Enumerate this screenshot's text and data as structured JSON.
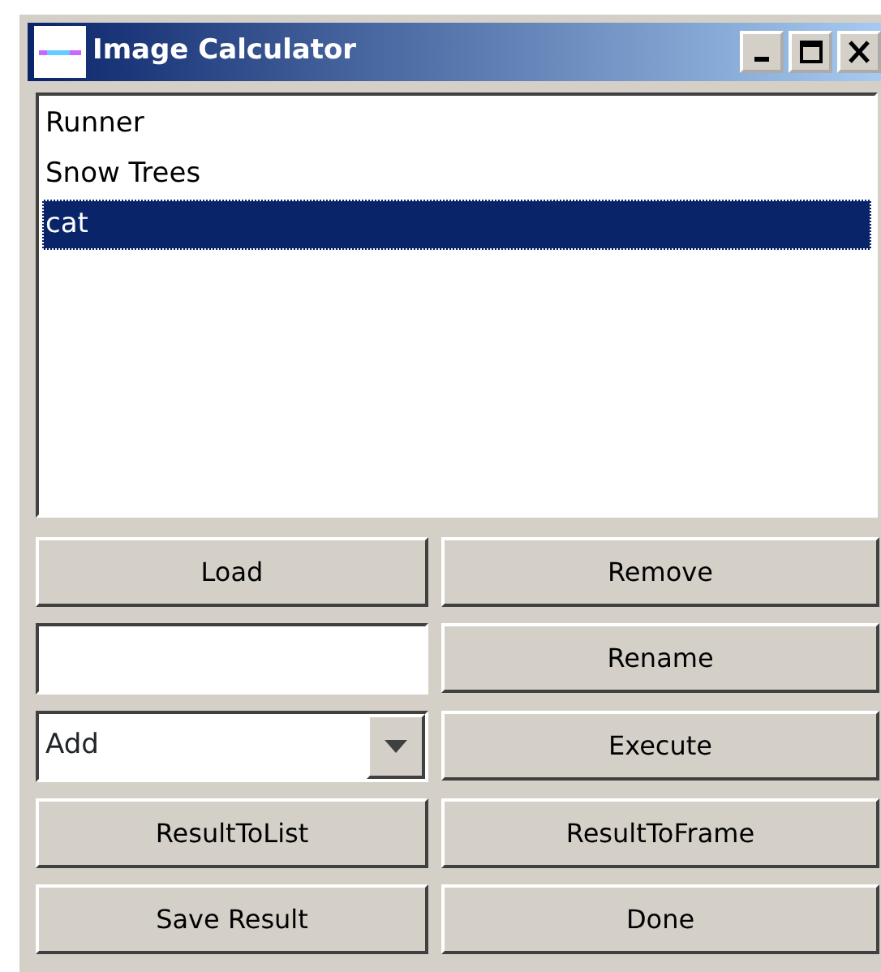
{
  "window": {
    "title": "Image Calculator",
    "buttons": [
      {
        "kind": "minimize"
      },
      {
        "kind": "maximize"
      },
      {
        "kind": "close"
      }
    ]
  },
  "image_list": [
    {
      "label": "Runner",
      "selected": false
    },
    {
      "label": "Snow Trees",
      "selected": false
    },
    {
      "label": "cat",
      "selected": true
    }
  ],
  "controls": [
    {
      "kind": "button",
      "label": "Load"
    },
    {
      "kind": "button",
      "label": "Remove"
    },
    {
      "kind": "text-field"
    },
    {
      "kind": "button",
      "label": "Rename"
    },
    {
      "kind": "dropdown",
      "value": "Add"
    },
    {
      "kind": "button",
      "label": "Execute"
    },
    {
      "kind": "button",
      "label": "ResultToList"
    },
    {
      "kind": "button",
      "label": "ResultToFrame"
    },
    {
      "kind": "button",
      "label": "Save Result"
    },
    {
      "kind": "button",
      "label": "Done"
    }
  ]
}
